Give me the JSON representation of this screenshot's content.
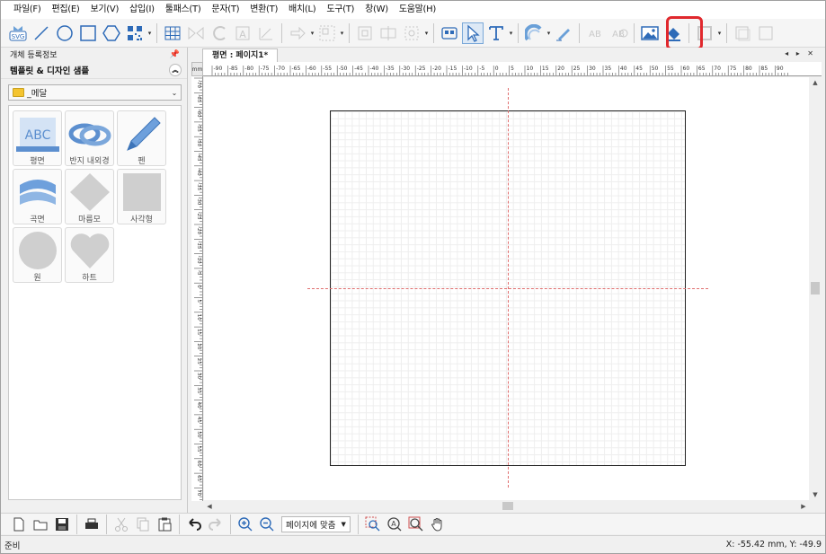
{
  "menubar": {
    "items": [
      "파일(F)",
      "편집(E)",
      "보기(V)",
      "삽입(I)",
      "툴패스(T)",
      "문자(T)",
      "변환(T)",
      "배치(L)",
      "도구(T)",
      "창(W)",
      "도움말(H)"
    ]
  },
  "toolbar": {
    "svg_label": "SVG",
    "text_ab": "AB",
    "highlighted_tool": "insert-image"
  },
  "left_panel": {
    "header": "개체 등록정보",
    "subheader": "템플릿 & 디자인 샘플",
    "template_select": "_메달",
    "shapes": [
      {
        "label": "평면",
        "icon": "flat-abc-icon"
      },
      {
        "label": "반지 내외경",
        "icon": "ring-abc-icon"
      },
      {
        "label": "펜",
        "icon": "pen-icon"
      },
      {
        "label": "곡면",
        "icon": "curved-abc-icon"
      },
      {
        "label": "마름모",
        "icon": "diamond-shape-icon"
      },
      {
        "label": "사각형",
        "icon": "square-shape-icon"
      },
      {
        "label": "원",
        "icon": "circle-shape-icon"
      },
      {
        "label": "하트",
        "icon": "heart-shape-icon"
      }
    ],
    "abc_text": "ABC"
  },
  "document": {
    "tab_label": "평면 : 페이지1*",
    "corner_label": "mm"
  },
  "ruler": {
    "h_labels": [
      "-90",
      "-85",
      "-80",
      "-75",
      "-70",
      "-65",
      "-60",
      "-55",
      "-50",
      "-45",
      "-40",
      "-35",
      "-30",
      "-25",
      "-20",
      "-15",
      "-10",
      "-5",
      "0",
      "5",
      "10",
      "15",
      "20",
      "25",
      "30",
      "35",
      "40",
      "45",
      "50",
      "55",
      "60",
      "65",
      "70",
      "75",
      "80",
      "85",
      "90"
    ],
    "v_labels": [
      "-70",
      "-65",
      "-60",
      "-55",
      "-50",
      "-45",
      "-40",
      "-35",
      "-30",
      "-25",
      "-20",
      "-15",
      "-10",
      "-5",
      "0",
      "5",
      "10",
      "15",
      "20",
      "25",
      "30",
      "35",
      "40",
      "45",
      "50",
      "55",
      "60",
      "65",
      "70"
    ]
  },
  "bottombar": {
    "zoom_value": "페이지에 맞춤"
  },
  "statusbar": {
    "status": "준비",
    "coords": "X: -55.42 mm,  Y: -49.9"
  },
  "colors": {
    "highlight": "#e0282d",
    "accent_blue": "#2e6bb8",
    "guide": "#e07070"
  }
}
